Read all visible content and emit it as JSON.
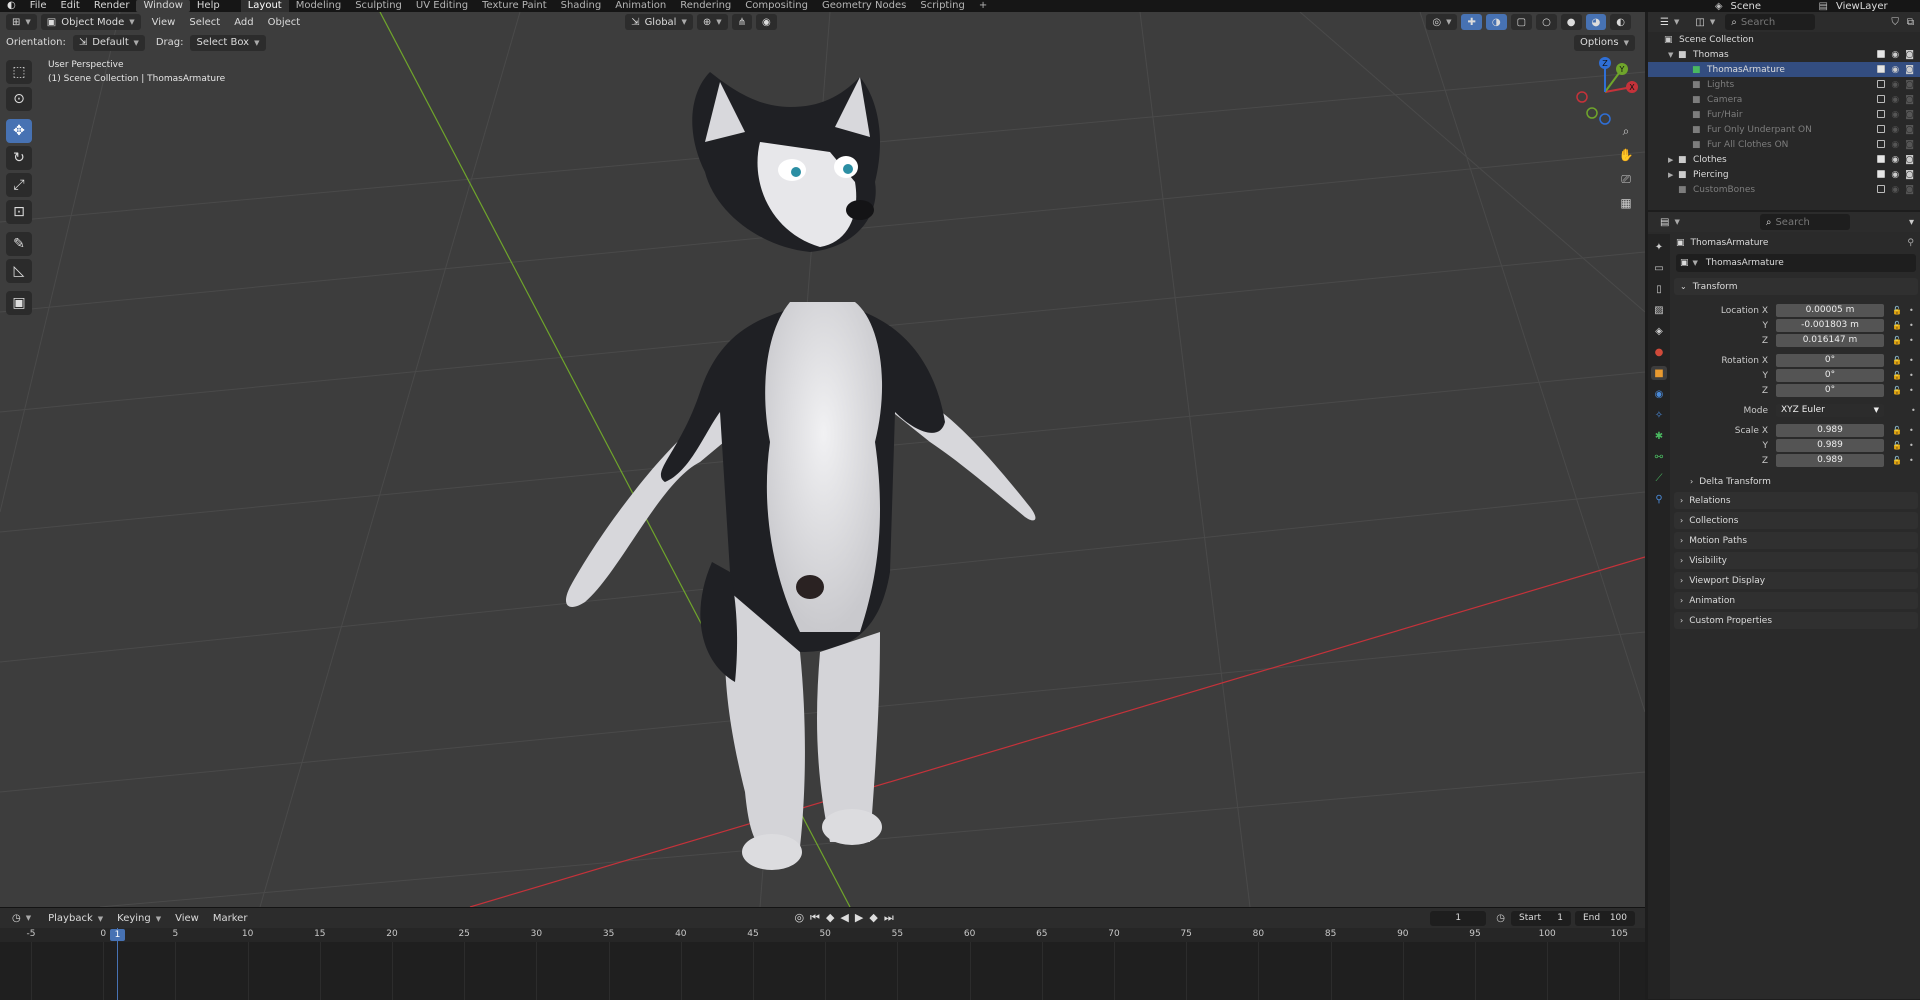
{
  "topbar": {
    "menus": [
      "File",
      "Edit",
      "Render",
      "Window",
      "Help"
    ],
    "active_menu": "Window",
    "workspaces": [
      "Layout",
      "Modeling",
      "Sculpting",
      "UV Editing",
      "Texture Paint",
      "Shading",
      "Animation",
      "Rendering",
      "Compositing",
      "Geometry Nodes",
      "Scripting"
    ],
    "active_workspace": "Layout",
    "add_tab": "+",
    "scene": "Scene",
    "view_layer": "ViewLayer"
  },
  "viewport": {
    "mode": "Object Mode",
    "menus": [
      "View",
      "Select",
      "Add",
      "Object"
    ],
    "transform_orientation": "Global",
    "orientation_label": "Orientation:",
    "orientation_value": "Default",
    "drag_label": "Drag:",
    "drag_value": "Select Box",
    "options": "Options",
    "perspective": "User Perspective",
    "collection_info": "(1) Scene Collection | ThomasArmature",
    "axis_labels": {
      "x": "X",
      "y": "Y",
      "z": "Z"
    }
  },
  "timeline": {
    "menus": [
      "Playback",
      "Keying",
      "View",
      "Marker"
    ],
    "current_frame": "1",
    "start_label": "Start",
    "start": "1",
    "end_label": "End",
    "end": "100",
    "ruler": [
      "-5",
      "0",
      "5",
      "10",
      "15",
      "20",
      "25",
      "30",
      "35",
      "40",
      "45",
      "50",
      "55",
      "60",
      "65",
      "70",
      "75",
      "80",
      "85",
      "90",
      "95",
      "100",
      "105"
    ],
    "playhead_label": "1"
  },
  "outliner": {
    "search_placeholder": "Search",
    "items": [
      {
        "label": "Scene Collection",
        "indent": 0,
        "state": "normal"
      },
      {
        "label": "Thomas",
        "indent": 1,
        "state": "normal"
      },
      {
        "label": "ThomasArmature",
        "indent": 2,
        "state": "selected"
      },
      {
        "label": "Lights",
        "indent": 2,
        "state": "dim"
      },
      {
        "label": "Camera",
        "indent": 2,
        "state": "dim"
      },
      {
        "label": "Fur/Hair",
        "indent": 2,
        "state": "dim"
      },
      {
        "label": "Fur Only Underpant ON",
        "indent": 2,
        "state": "dim"
      },
      {
        "label": "Fur All Clothes ON",
        "indent": 2,
        "state": "dim"
      },
      {
        "label": "Clothes",
        "indent": 1,
        "state": "normal"
      },
      {
        "label": "Piercing",
        "indent": 1,
        "state": "normal"
      },
      {
        "label": "CustomBones",
        "indent": 1,
        "state": "dim"
      }
    ]
  },
  "properties": {
    "search_placeholder": "Search",
    "object_name": "ThomasArmature",
    "datablock": "ThomasArmature",
    "transform_title": "Transform",
    "location_label": "Location X",
    "location": [
      "0.00005 m",
      "-0.001803 m",
      "0.016147 m"
    ],
    "rotation_label": "Rotation X",
    "rotation": [
      "0°",
      "0°",
      "0°"
    ],
    "mode_label": "Mode",
    "mode": "XYZ Euler",
    "scale_label": "Scale X",
    "scale": [
      "0.989",
      "0.989",
      "0.989"
    ],
    "axis_y": "Y",
    "axis_z": "Z",
    "delta_transform": "Delta Transform",
    "panels": [
      "Relations",
      "Collections",
      "Motion Paths",
      "Visibility",
      "Viewport Display",
      "Animation",
      "Custom Properties"
    ]
  },
  "colors": {
    "accent": "#4772b3",
    "x_axis": "#c5323a",
    "y_axis": "#6fa52b",
    "z_axis": "#2f6fd6"
  }
}
